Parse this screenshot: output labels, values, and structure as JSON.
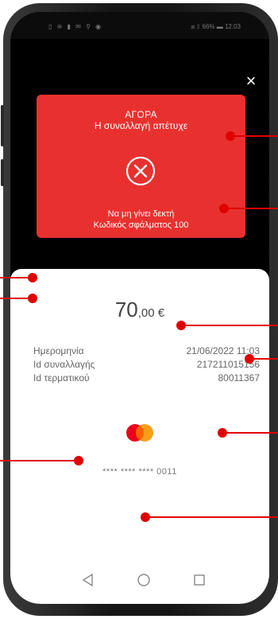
{
  "statusbar": {
    "left_icons": "▯ ≋ ▮ ✉ ⚲ ◉",
    "right_text": "⊠ ᛒ 66% ▬ 12:03"
  },
  "close_icon": "×",
  "result": {
    "title": "ΑΓΟΡΑ",
    "status": "Η συναλλαγή απέτυχε",
    "message": "Να μη γίνει δεκτή",
    "error_code": "Κωδικός σφάλματος 100",
    "bg_color": "#e8312f"
  },
  "amount": {
    "integer": "70",
    "decimal": ",00 €"
  },
  "details": [
    {
      "label": "Ημερομηνία",
      "value": "21/06/2022 11:03"
    },
    {
      "label": "Id συναλλαγής",
      "value": "217211015156"
    },
    {
      "label": "Id τερματικού",
      "value": "80011367"
    }
  ],
  "card": {
    "brand_icon": "mastercard-logo",
    "number": "**** **** **** 0011"
  },
  "navbar": {
    "back_icon": "triangle-back-icon",
    "home_icon": "circle-home-icon",
    "recents_icon": "square-recents-icon"
  },
  "annotation_color": "#e10000"
}
